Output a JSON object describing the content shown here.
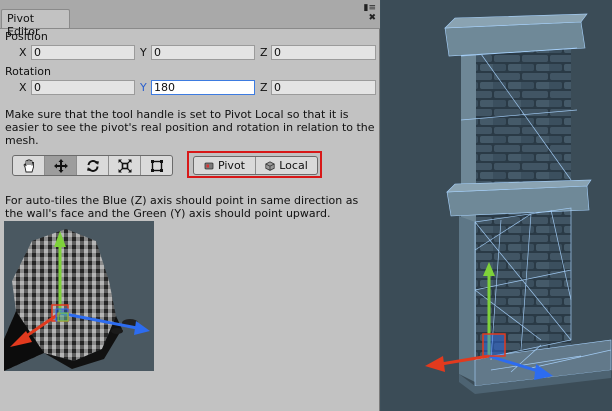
{
  "window": {
    "tab_title": "Pivot Editor"
  },
  "position": {
    "label": "Position",
    "x_label": "X",
    "x": "0",
    "y_label": "Y",
    "y": "0",
    "z_label": "Z",
    "z": "0"
  },
  "rotation": {
    "label": "Rotation",
    "x_label": "X",
    "x": "0",
    "y_label": "Y",
    "y": "180",
    "z_label": "Z",
    "z": "0"
  },
  "help_text": "Make sure that the tool handle is set to Pivot Local so that it is easier to see the pivot's real position and rotation in relation to the mesh.",
  "tools": {
    "items": [
      "hand-icon",
      "move-icon",
      "rotate-icon",
      "scale-icon",
      "rect-icon"
    ],
    "active": "move-icon"
  },
  "pivot_toggle": {
    "pivot_label": "Pivot",
    "local_label": "Local"
  },
  "auto_tile_text": "For auto-tiles the Blue (Z) axis should point in same direction as the wall's face and the Green (Y) axis should point upward.",
  "colors": {
    "x_axis": "#e23a1e",
    "y_axis": "#7ed13a",
    "z_axis": "#2d6cf0",
    "highlight_box": "#d81818"
  }
}
